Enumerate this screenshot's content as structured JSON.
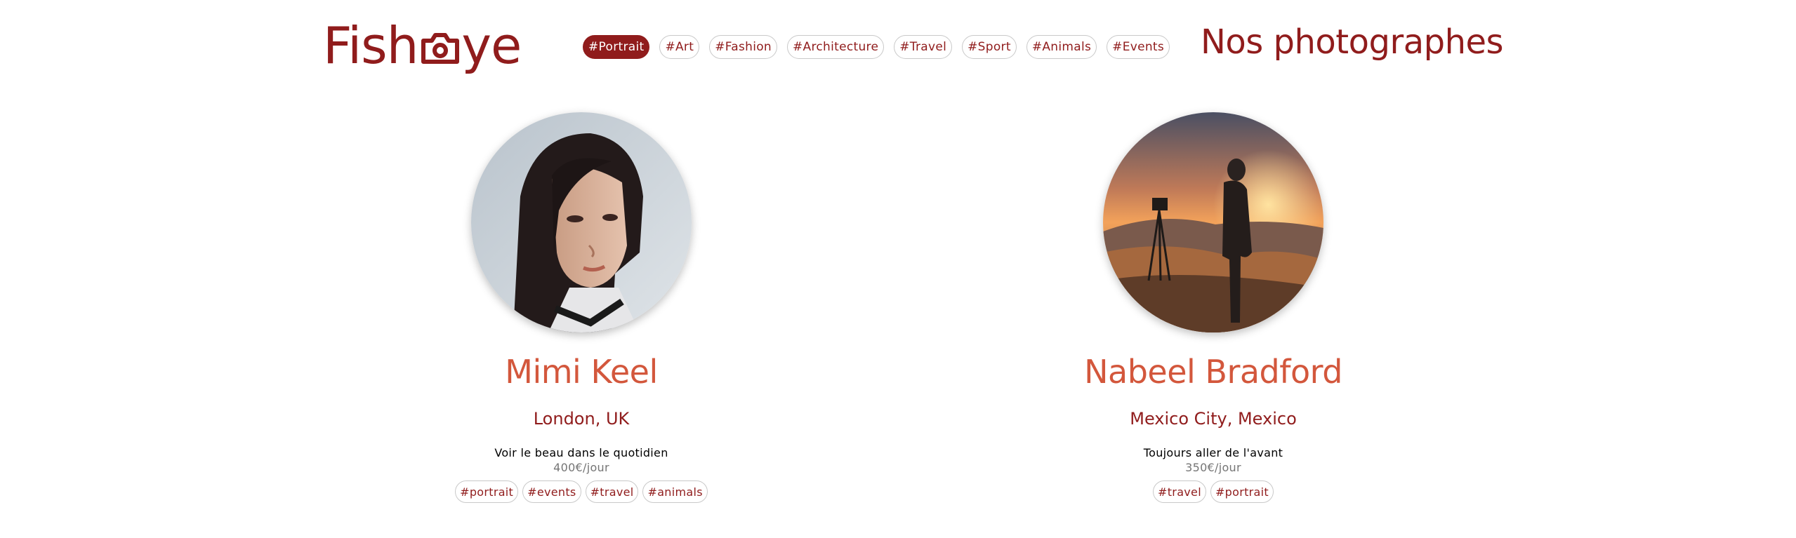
{
  "header": {
    "logo_text_left": "Fish",
    "logo_text_right": "ye",
    "logo_icon": "camera-icon",
    "nav_tags": [
      {
        "label": "#Portrait",
        "active": true
      },
      {
        "label": "#Art",
        "active": false
      },
      {
        "label": "#Fashion",
        "active": false
      },
      {
        "label": "#Architecture",
        "active": false
      },
      {
        "label": "#Travel",
        "active": false
      },
      {
        "label": "#Sport",
        "active": false
      },
      {
        "label": "#Animals",
        "active": false
      },
      {
        "label": "#Events",
        "active": false
      }
    ],
    "page_title": "Nos photographes"
  },
  "photographers": [
    {
      "name": "Mimi Keel",
      "location": "London, UK",
      "tagline": "Voir le beau dans le quotidien",
      "price": "400€/jour",
      "tags": [
        "#portrait",
        "#events",
        "#travel",
        "#animals"
      ]
    },
    {
      "name": "Nabeel Bradford",
      "location": "Mexico City, Mexico",
      "tagline": "Toujours aller de l'avant",
      "price": "350€/jour",
      "tags": [
        "#travel",
        "#portrait"
      ]
    }
  ],
  "colors": {
    "brand": "#901c1c",
    "name_accent": "#d3573c",
    "muted": "#757575",
    "tag_border": "#c9c9c9"
  }
}
